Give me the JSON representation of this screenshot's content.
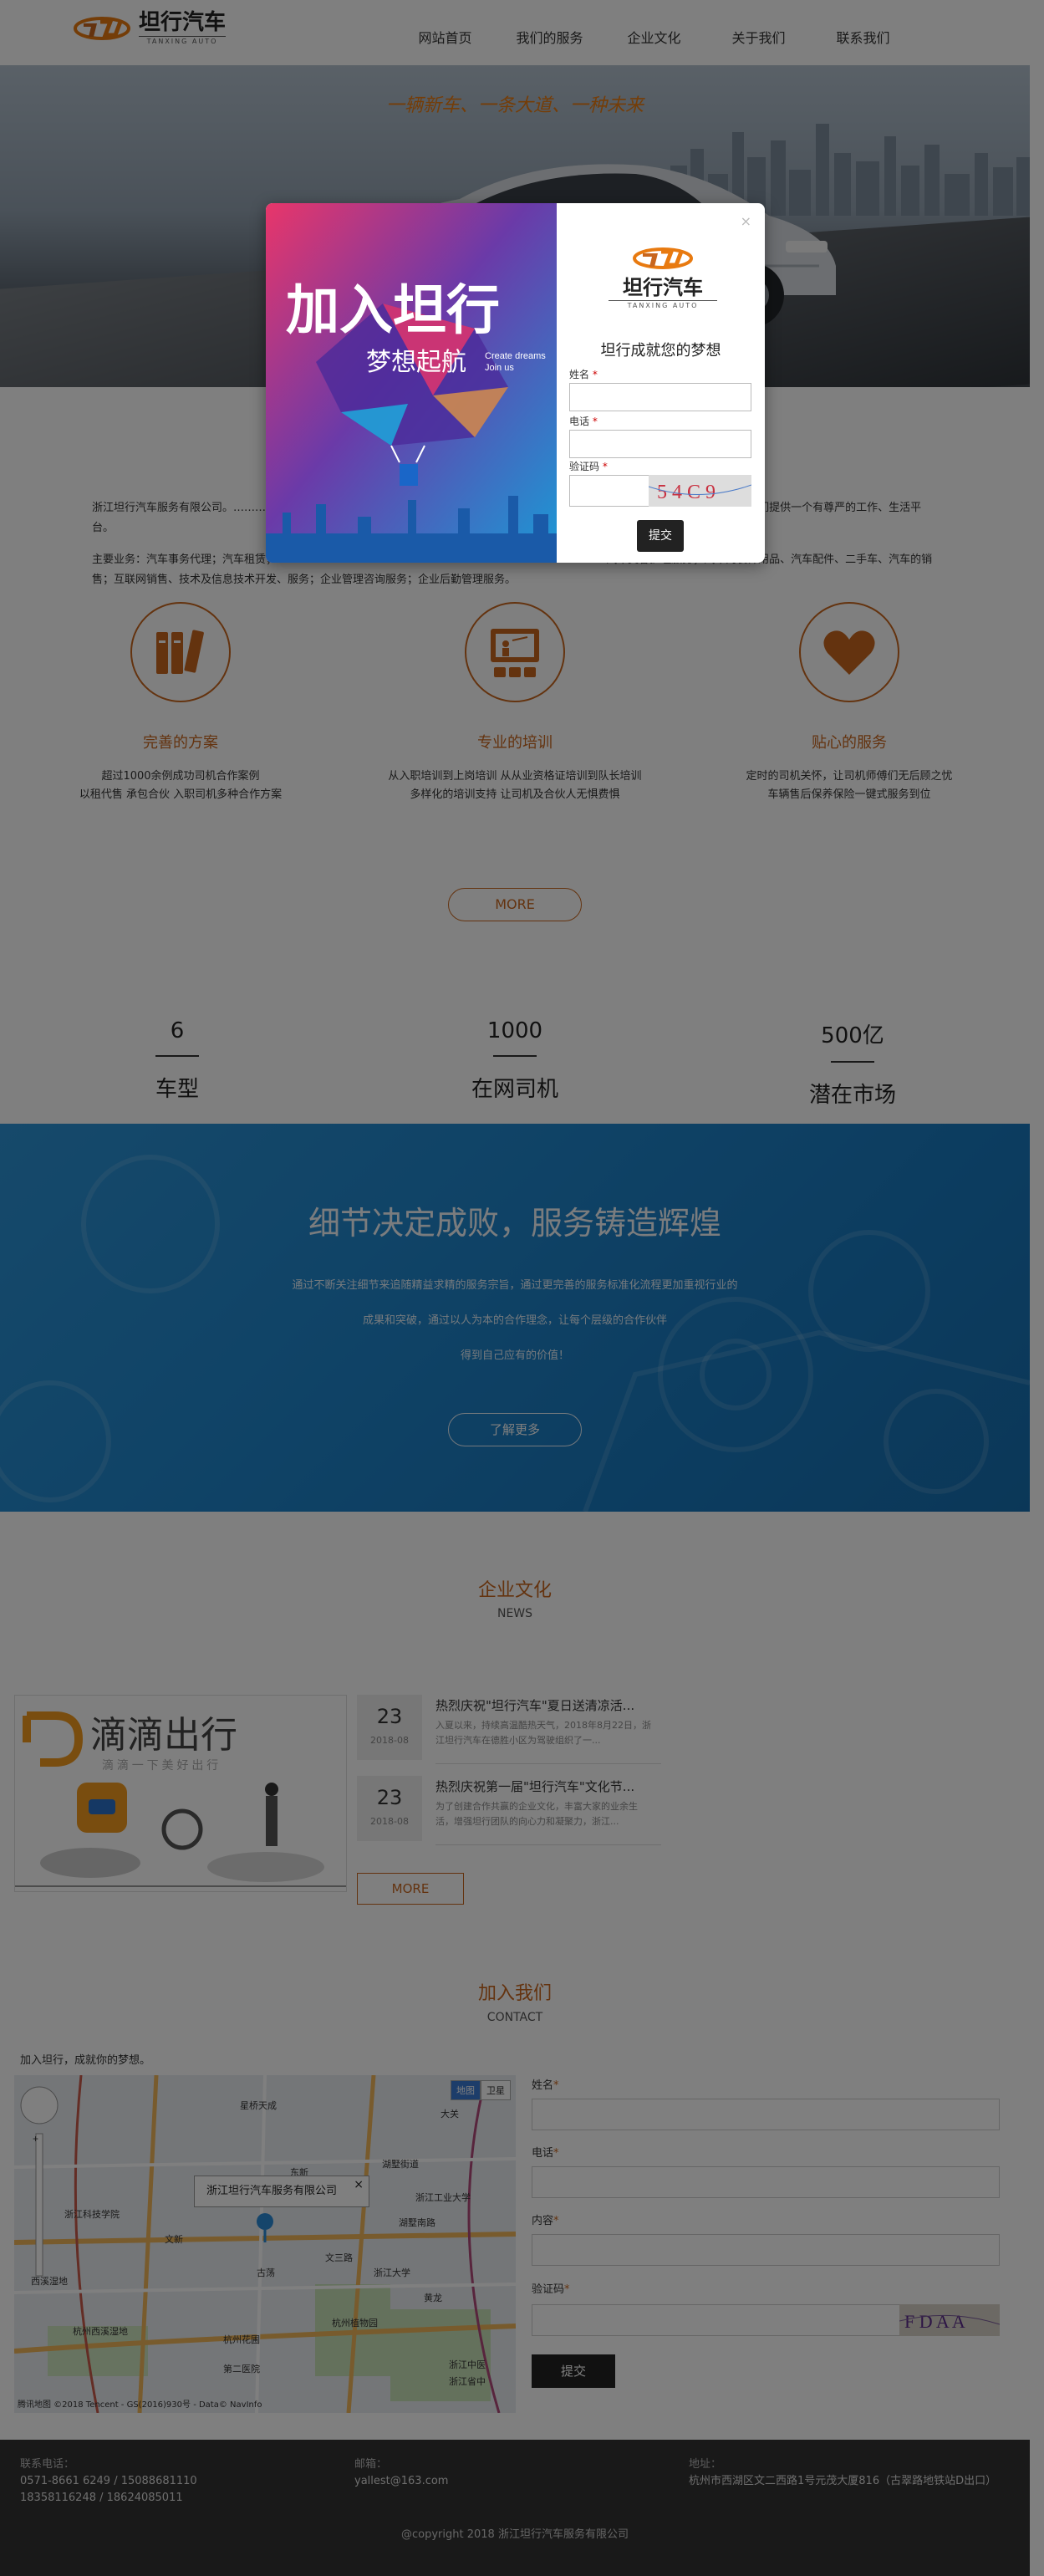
{
  "header": {
    "brand": "坦行汽车",
    "brand_en": "TANXING AUTO",
    "nav": [
      "网站首页",
      "我们的服务",
      "企业文化",
      "关于我们",
      "联系我们"
    ]
  },
  "hero": {
    "slogan": "一辆新车、一条大道、一种未来"
  },
  "intro": {
    "p1": "浙江坦行汽车服务有限公司。……………………………………………………………………………………………… 整合社会网路资源，为司机们提供一个有尊严的工作、生活平台。",
    "p2": "主要业务：汽车事务代理；汽车租赁；……………………………………………………………………………… 汽车美容护理服务；汽车内装饰用品、汽车配件、二手车、汽车的销售；互联网销售、技术及信息技术开发、服务；企业管理咨询服务；企业后勤管理服务。"
  },
  "features": [
    {
      "title": "完善的方案",
      "desc1": "超过1000余例成功司机合作案例",
      "desc2": "以租代售 承包合伙 入职司机多种合作方案",
      "icon": "books-icon"
    },
    {
      "title": "专业的培训",
      "desc1": "从入职培训到上岗培训 从从业资格证培训到队长培训",
      "desc2": "多样化的培训支持 让司机及合伙人无惧费惧",
      "icon": "presentation-icon"
    },
    {
      "title": "贴心的服务",
      "desc1": "定时的司机关怀，让司机师傅们无后顾之忧",
      "desc2": "车辆售后保养保险一键式服务到位",
      "icon": "heart-icon"
    }
  ],
  "more_label": "MORE",
  "stats": [
    {
      "num": "6",
      "label": "车型"
    },
    {
      "num": "1000",
      "label": "在网司机"
    },
    {
      "num": "500亿",
      "label": "潜在市场"
    }
  ],
  "blue": {
    "title": "细节决定成败，服务铸造辉煌",
    "line1": "通过不断关注细节来追随精益求精的服务宗旨，通过更完善的服务标准化流程更加重视行业的",
    "line2": "成果和突破，通过以人为本的合作理念，让每个层级的合作伙伴",
    "line3": "得到自己应有的价值！",
    "button": "了解更多"
  },
  "culture": {
    "title": "企业文化",
    "sub": "NEWS",
    "didi_cn": "滴滴出行",
    "didi_slogan": "滴 滴 一 下  美 好 出 行",
    "news": [
      {
        "day": "23",
        "ym": "2018-08",
        "title": "热烈庆祝\"坦行汽车\"夏日送清凉活...",
        "desc": "入夏以来，持续高温酷热天气，2018年8月22日，浙江坦行汽车在德胜小区为驾驶组织了一..."
      },
      {
        "day": "23",
        "ym": "2018-08",
        "title": "热烈庆祝第一届\"坦行汽车\"文化节...",
        "desc": "为了创建合作共赢的企业文化，丰富大家的业余生活，增强坦行团队的向心力和凝聚力，浙江..."
      }
    ],
    "more": "MORE"
  },
  "contact": {
    "title": "加入我们",
    "sub": "CONTACT",
    "note": "加入坦行，成就你的梦想。",
    "map": {
      "card": "浙江坦行汽车服务有限公司",
      "close": "×",
      "types": [
        "地图",
        "卫星"
      ],
      "footer": "腾讯地图 ©2018 Tencent - GS(2016)930号 - Data© NavInfo",
      "places": [
        "星桥天成",
        "大关",
        "湖墅街道",
        "浙江工业大学",
        "湖墅南路",
        "文三路",
        "古荡",
        "浙江大学",
        "文新",
        "西溪湿地",
        "杭州西溪湿地",
        "东新",
        "浙江科技学院",
        "杭州花圃",
        "杭州植物园",
        "黄龙",
        "浙江中医",
        "浙江省中",
        "第二医院"
      ]
    },
    "fields": [
      {
        "label": "姓名",
        "req": "*"
      },
      {
        "label": "电话",
        "req": "*"
      },
      {
        "label": "内容",
        "req": "*"
      },
      {
        "label": "验证码",
        "req": "*"
      }
    ],
    "captcha": "F D A A",
    "submit": "提交"
  },
  "footer": {
    "phone_label": "联系电话：",
    "phone1": "0571-8661 6249 / 15088681110",
    "phone2": "18358116248 / 18624085011",
    "email_label": "邮箱：",
    "email": "yallest@163.com",
    "addr_label": "地址：",
    "addr": "杭州市西湖区文二西路1号元茂大厦816（古翠路地铁站D出口）",
    "copyright": "@copyright 2018 浙江坦行汽车服务有限公司"
  },
  "modal": {
    "close": "×",
    "art_cn1": "加入坦行",
    "art_cn2": "梦想起航",
    "art_en1": "Create dreams",
    "art_en2": "Join us",
    "brand": "坦行汽车",
    "brand_en": "TANXING AUTO",
    "title": "坦行成就您的梦想",
    "fields": [
      {
        "label": "姓名",
        "req": "*"
      },
      {
        "label": "电话",
        "req": "*"
      },
      {
        "label": "验证码",
        "req": "*"
      }
    ],
    "captcha": "5 4 C 9",
    "submit": "提交"
  },
  "colors": {
    "accent": "#c8661e",
    "blue": "#1f86cd",
    "footer": "#333333"
  }
}
